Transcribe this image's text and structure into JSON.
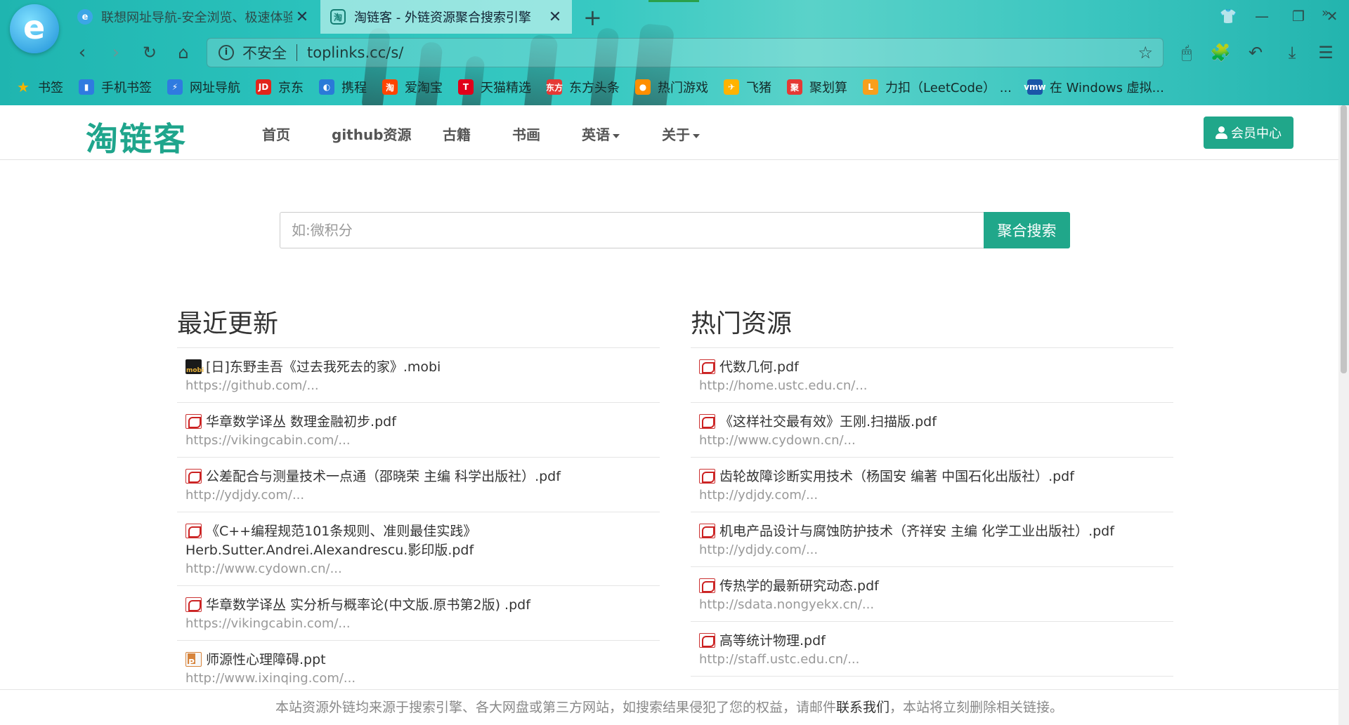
{
  "browser": {
    "tabs": [
      {
        "title": "联想网址导航-安全浏览、极速体验",
        "icon": "e",
        "close": "✕"
      },
      {
        "title": "淘链客 - 外链资源聚合搜索引擎",
        "icon": "淘",
        "close": "✕"
      }
    ],
    "new_tab": "+",
    "address": {
      "security": "不安全",
      "url": "toplinks.cc/s/"
    },
    "bookmarks": [
      {
        "label": "书签",
        "icon": "star-icon",
        "color": "#f5b400"
      },
      {
        "label": "手机书签",
        "icon": "phone-icon",
        "color": "#2f7be0"
      },
      {
        "label": "网址导航",
        "icon": "nav-icon",
        "color": "#2f7be0"
      },
      {
        "label": "京东",
        "icon": "JD",
        "color": "#e1251b"
      },
      {
        "label": "携程",
        "icon": "ctrip-icon",
        "color": "#2a7ad8"
      },
      {
        "label": "爱淘宝",
        "icon": "淘",
        "color": "#ff4400"
      },
      {
        "label": "天猫精选",
        "icon": "T",
        "color": "#e1001a"
      },
      {
        "label": "东方头条",
        "icon": "东方",
        "color": "#e53935"
      },
      {
        "label": "热门游戏",
        "icon": "game-icon",
        "color": "#ff8f00"
      },
      {
        "label": "飞猪",
        "icon": "pig-icon",
        "color": "#ffb300"
      },
      {
        "label": "聚划算",
        "icon": "聚",
        "color": "#e53935"
      },
      {
        "label": "力扣（LeetCode） ...",
        "icon": "leetcode-icon",
        "color": "#f89f1b"
      },
      {
        "label": "在 Windows 虚拟...",
        "icon": "vmw",
        "color": "#1a56a8"
      }
    ],
    "more": "»"
  },
  "site": {
    "logo": "淘链客",
    "nav": [
      {
        "label": "首页",
        "dropdown": false
      },
      {
        "label": "github资源",
        "dropdown": false
      },
      {
        "label": "古籍",
        "dropdown": false
      },
      {
        "label": "书画",
        "dropdown": false
      },
      {
        "label": "英语",
        "dropdown": true
      },
      {
        "label": "关于",
        "dropdown": true
      }
    ],
    "member_button": "会员中心",
    "search": {
      "placeholder": "如:微积分",
      "button": "聚合搜索"
    }
  },
  "recent": {
    "title": "最近更新",
    "items": [
      {
        "type": "mobi",
        "title": "[日]东野圭吾《过去我死去的家》.mobi",
        "src": "https://github.com/..."
      },
      {
        "type": "pdf",
        "title": "华章数学译丛 数理金融初步.pdf",
        "src": "https://vikingcabin.com/..."
      },
      {
        "type": "pdf",
        "title": "公差配合与测量技术一点通（邵晓荣 主编 科学出版社）.pdf",
        "src": "http://ydjdy.com/..."
      },
      {
        "type": "pdf",
        "title": "《C++编程规范101条规则、准则最佳实践》Herb.Sutter.Andrei.Alexandrescu.影印版.pdf",
        "src": "http://www.cydown.cn/..."
      },
      {
        "type": "pdf",
        "title": "华章数学译丛 实分析与概率论(中文版.原书第2版) .pdf",
        "src": "https://vikingcabin.com/..."
      },
      {
        "type": "ppt",
        "title": "师源性心理障碍.ppt",
        "src": "http://www.ixinqing.com/..."
      }
    ]
  },
  "hot": {
    "title": "热门资源",
    "items": [
      {
        "type": "pdf",
        "title": "代数几何.pdf",
        "src": "http://home.ustc.edu.cn/..."
      },
      {
        "type": "pdf",
        "title": "《这样社交最有效》王刚.扫描版.pdf",
        "src": "http://www.cydown.cn/..."
      },
      {
        "type": "pdf",
        "title": "齿轮故障诊断实用技术（杨国安 编著 中国石化出版社）.pdf",
        "src": "http://ydjdy.com/..."
      },
      {
        "type": "pdf",
        "title": "机电产品设计与腐蚀防护技术（齐祥安 主编 化学工业出版社）.pdf",
        "src": "http://ydjdy.com/..."
      },
      {
        "type": "pdf",
        "title": "传热学的最新研究动态.pdf",
        "src": "http://sdata.nongyekx.cn/..."
      },
      {
        "type": "pdf",
        "title": "高等统计物理.pdf",
        "src": "http://staff.ustc.edu.cn/..."
      }
    ]
  },
  "footer": {
    "text_before": "本站资源外链均来源于搜索引擎、各大网盘或第三方网站，如搜索结果侵犯了您的权益，请邮件",
    "link": "联系我们",
    "text_after": "，本站将立刻删除相关链接。"
  }
}
